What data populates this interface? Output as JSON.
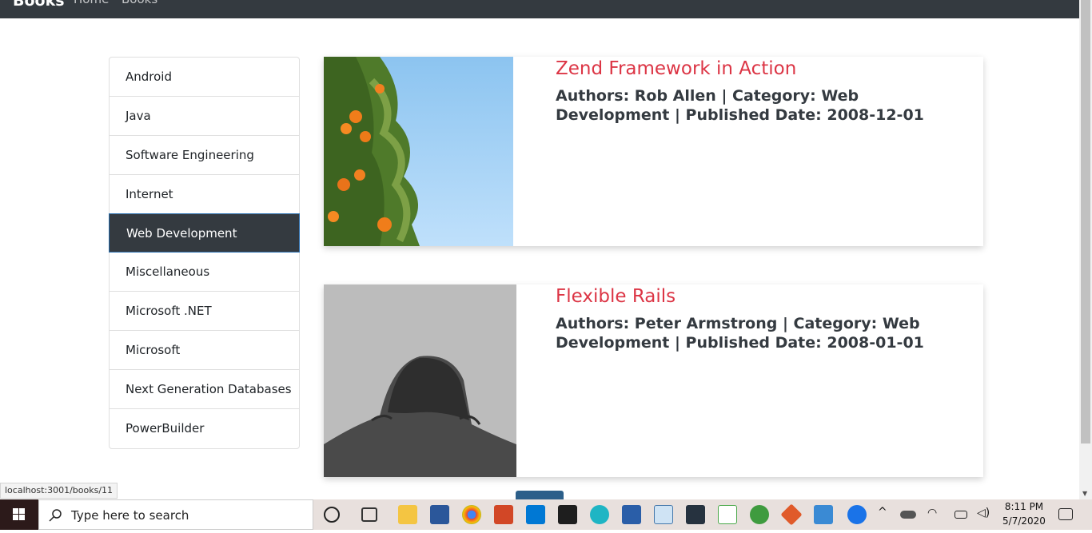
{
  "navbar": {
    "brand": "Books",
    "links": [
      "Home",
      "Books"
    ]
  },
  "sidebar": {
    "items": [
      {
        "label": "Android",
        "active": false
      },
      {
        "label": "Java",
        "active": false
      },
      {
        "label": "Software Engineering",
        "active": false
      },
      {
        "label": "Internet",
        "active": false
      },
      {
        "label": "Web Development",
        "active": true
      },
      {
        "label": "Miscellaneous",
        "active": false
      },
      {
        "label": "Microsoft .NET",
        "active": false
      },
      {
        "label": "Microsoft",
        "active": false
      },
      {
        "label": "Next Generation Databases",
        "active": false
      },
      {
        "label": "PowerBuilder",
        "active": false
      }
    ]
  },
  "books": [
    {
      "title": "Zend Framework in Action",
      "meta": "Authors: Rob Allen | Category: Web Development | Published Date: 2008-12-01",
      "image": "orange-tree-photo"
    },
    {
      "title": "Flexible Rails",
      "meta": "Authors: Peter Armstrong | Category: Web Development | Published Date: 2008-01-01",
      "image": "grayscale-person-photo"
    }
  ],
  "status_url": "localhost:3001/books/11",
  "taskbar": {
    "search_placeholder": "Type here to search",
    "time": "8:11 PM",
    "date": "5/7/2020"
  },
  "colors": {
    "navbar": "#343a40",
    "title": "#dc3545",
    "active": "#343a40"
  }
}
